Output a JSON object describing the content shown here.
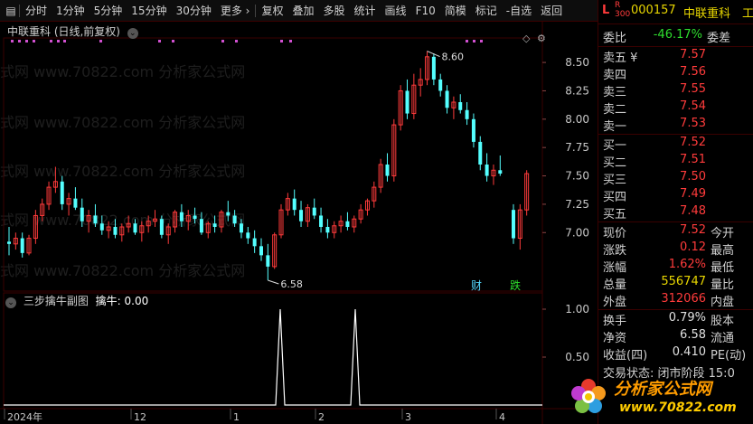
{
  "toolbar": {
    "items": [
      "分时",
      "1分钟",
      "5分钟",
      "15分钟",
      "30分钟",
      "更多 ›",
      "复权",
      "叠加",
      "多股",
      "统计",
      "画线",
      "F10",
      "简模",
      "标记",
      "-自选",
      "返回"
    ]
  },
  "chart": {
    "title": "中联重科 (日线,前复权)",
    "high_label": "8.60",
    "low_label": "6.58",
    "event_cai": "财",
    "event_die": "跌",
    "price_ticks": [
      "8.50",
      "8.25",
      "8.00",
      "7.75",
      "7.50",
      "7.25",
      "7.00"
    ],
    "date_ticks": [
      "2024年",
      "12",
      "1",
      "2",
      "3",
      "4"
    ],
    "sub_title": "三步擒牛副图",
    "sub_value": "擒牛: 0.00",
    "sub_ticks": [
      "1.00",
      "0.50"
    ],
    "watermark": "式网 www.70822.com 分析家公式网"
  },
  "chart_data": {
    "type": "candlestick",
    "title": "中联重科 (日线,前复权)",
    "ylim": [
      6.5,
      8.7
    ],
    "x_ticks": [
      "2024年",
      "12",
      "1",
      "2",
      "3",
      "4"
    ],
    "y_ticks": [
      7.0,
      7.25,
      7.5,
      7.75,
      8.0,
      8.25,
      8.5
    ],
    "annotations": [
      {
        "text": "8.60",
        "type": "high"
      },
      {
        "text": "6.58",
        "type": "low"
      }
    ],
    "ohlc": [
      [
        6.92,
        7.05,
        6.8,
        6.9
      ],
      [
        6.9,
        7.0,
        6.85,
        6.95
      ],
      [
        6.95,
        7.0,
        6.78,
        6.82
      ],
      [
        6.82,
        6.98,
        6.8,
        6.95
      ],
      [
        6.95,
        7.2,
        6.9,
        7.15
      ],
      [
        7.15,
        7.3,
        7.1,
        7.25
      ],
      [
        7.25,
        7.45,
        7.2,
        7.4
      ],
      [
        7.4,
        7.58,
        7.35,
        7.45
      ],
      [
        7.45,
        7.5,
        7.2,
        7.25
      ],
      [
        7.25,
        7.35,
        7.15,
        7.3
      ],
      [
        7.3,
        7.4,
        7.2,
        7.22
      ],
      [
        7.22,
        7.3,
        7.05,
        7.1
      ],
      [
        7.1,
        7.2,
        7.0,
        7.15
      ],
      [
        7.15,
        7.25,
        7.05,
        7.08
      ],
      [
        7.08,
        7.15,
        6.98,
        7.02
      ],
      [
        7.02,
        7.1,
        6.95,
        7.05
      ],
      [
        7.05,
        7.12,
        6.95,
        6.98
      ],
      [
        6.98,
        7.08,
        6.92,
        7.05
      ],
      [
        7.05,
        7.15,
        7.0,
        7.08
      ],
      [
        7.08,
        7.12,
        6.98,
        7.0
      ],
      [
        7.0,
        7.1,
        6.92,
        7.06
      ],
      [
        7.06,
        7.15,
        7.0,
        7.1
      ],
      [
        7.1,
        7.2,
        7.05,
        7.12
      ],
      [
        7.12,
        7.15,
        6.95,
        6.98
      ],
      [
        6.98,
        7.08,
        6.9,
        7.05
      ],
      [
        7.05,
        7.2,
        7.0,
        7.18
      ],
      [
        7.18,
        7.25,
        7.05,
        7.1
      ],
      [
        7.1,
        7.2,
        7.02,
        7.15
      ],
      [
        7.15,
        7.22,
        7.08,
        7.12
      ],
      [
        7.12,
        7.18,
        6.98,
        7.0
      ],
      [
        7.0,
        7.1,
        6.95,
        7.08
      ],
      [
        7.08,
        7.15,
        7.0,
        7.05
      ],
      [
        7.05,
        7.2,
        7.0,
        7.18
      ],
      [
        7.18,
        7.28,
        7.1,
        7.15
      ],
      [
        7.15,
        7.2,
        7.05,
        7.08
      ],
      [
        7.08,
        7.12,
        6.95,
        7.0
      ],
      [
        7.0,
        7.05,
        6.9,
        6.95
      ],
      [
        6.95,
        7.02,
        6.82,
        6.88
      ],
      [
        6.88,
        6.95,
        6.75,
        6.8
      ],
      [
        6.8,
        6.9,
        6.58,
        6.7
      ],
      [
        6.7,
        7.0,
        6.68,
        6.98
      ],
      [
        6.98,
        7.25,
        6.95,
        7.2
      ],
      [
        7.2,
        7.35,
        7.15,
        7.3
      ],
      [
        7.3,
        7.38,
        7.15,
        7.2
      ],
      [
        7.2,
        7.28,
        7.05,
        7.1
      ],
      [
        7.1,
        7.25,
        7.05,
        7.22
      ],
      [
        7.22,
        7.3,
        7.12,
        7.15
      ],
      [
        7.15,
        7.22,
        7.0,
        7.05
      ],
      [
        7.05,
        7.12,
        6.95,
        7.0
      ],
      [
        7.0,
        7.1,
        6.95,
        7.06
      ],
      [
        7.06,
        7.15,
        7.0,
        7.1
      ],
      [
        7.1,
        7.18,
        7.02,
        7.05
      ],
      [
        7.05,
        7.15,
        7.0,
        7.12
      ],
      [
        7.12,
        7.25,
        7.08,
        7.2
      ],
      [
        7.2,
        7.3,
        7.15,
        7.28
      ],
      [
        7.28,
        7.45,
        7.22,
        7.4
      ],
      [
        7.4,
        7.65,
        7.35,
        7.6
      ],
      [
        7.6,
        7.7,
        7.45,
        7.5
      ],
      [
        7.5,
        8.0,
        7.45,
        7.95
      ],
      [
        7.95,
        8.3,
        7.9,
        8.25
      ],
      [
        8.25,
        8.35,
        8.0,
        8.05
      ],
      [
        8.05,
        8.4,
        8.0,
        8.3
      ],
      [
        8.3,
        8.45,
        8.2,
        8.35
      ],
      [
        8.35,
        8.6,
        8.3,
        8.55
      ],
      [
        8.55,
        8.58,
        8.3,
        8.35
      ],
      [
        8.35,
        8.4,
        8.2,
        8.25
      ],
      [
        8.25,
        8.3,
        8.05,
        8.1
      ],
      [
        8.1,
        8.2,
        8.0,
        8.15
      ],
      [
        8.15,
        8.22,
        8.05,
        8.08
      ],
      [
        8.08,
        8.15,
        7.95,
        8.0
      ],
      [
        8.0,
        8.05,
        7.75,
        7.8
      ],
      [
        7.8,
        7.85,
        7.55,
        7.6
      ],
      [
        7.6,
        7.7,
        7.45,
        7.5
      ],
      [
        7.5,
        7.6,
        7.42,
        7.55
      ],
      [
        7.55,
        7.68,
        7.5,
        7.52
      ],
      [
        7.2,
        7.25,
        6.9,
        6.95
      ],
      [
        6.95,
        7.25,
        6.85,
        7.2
      ],
      [
        7.2,
        7.55,
        7.15,
        7.52
      ]
    ]
  },
  "quote": {
    "flag": "L",
    "code": "000157",
    "name": "中联重科",
    "name_extra": "工",
    "weibi_label": "委比",
    "weibi_value": "-46.17%",
    "weicha_label": "委差",
    "asks": [
      {
        "label": "卖五 ¥",
        "price": "7.57"
      },
      {
        "label": "卖四",
        "price": "7.56"
      },
      {
        "label": "卖三",
        "price": "7.55"
      },
      {
        "label": "卖二",
        "price": "7.54"
      },
      {
        "label": "卖一",
        "price": "7.53"
      }
    ],
    "bids": [
      {
        "label": "买一",
        "price": "7.52"
      },
      {
        "label": "买二",
        "price": "7.51"
      },
      {
        "label": "买三",
        "price": "7.50"
      },
      {
        "label": "买四",
        "price": "7.49"
      },
      {
        "label": "买五",
        "price": "7.48"
      }
    ],
    "stats": [
      {
        "label": "现价",
        "value": "7.52",
        "label2": "今开",
        "color": "red"
      },
      {
        "label": "涨跌",
        "value": "0.12",
        "label2": "最高",
        "color": "red"
      },
      {
        "label": "涨幅",
        "value": "1.62%",
        "label2": "最低",
        "color": "red"
      },
      {
        "label": "总量",
        "value": "556747",
        "label2": "量比",
        "color": "yellow"
      },
      {
        "label": "外盘",
        "value": "312066",
        "label2": "内盘",
        "color": "red"
      }
    ],
    "stats2": [
      {
        "label": "换手",
        "value": "0.79%",
        "label2": "股本"
      },
      {
        "label": "净资",
        "value": "6.58",
        "label2": "流通"
      },
      {
        "label": "收益(四)",
        "value": "0.410",
        "label2": "PE(动)"
      }
    ],
    "footer_text": "交易状态: 闭市阶段 15:0"
  },
  "logo": {
    "text": "分析家公式网",
    "url_text": "www.70822.com"
  }
}
